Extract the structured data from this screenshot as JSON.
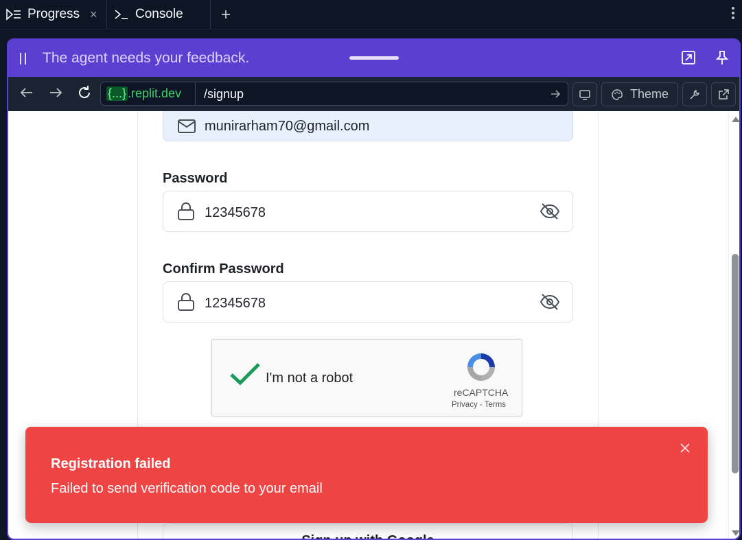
{
  "tabs": [
    {
      "label": "Progress",
      "close": "×"
    },
    {
      "label": "Console"
    }
  ],
  "tab_add": "+",
  "feedback": {
    "text": "The agent needs your feedback."
  },
  "urlbar": {
    "host_braces": "{...}",
    "host_domain": ".replit.dev",
    "path": "/signup",
    "theme_label": "Theme"
  },
  "form": {
    "email_value": "munirarham70@gmail.com",
    "password_label": "Password",
    "password_value": "12345678",
    "confirm_label": "Confirm Password",
    "confirm_value": "12345678",
    "google_button": "Sign up with Google"
  },
  "captcha": {
    "text": "I'm not a robot",
    "brand": "reCAPTCHA",
    "links": "Privacy - Terms"
  },
  "toast": {
    "title": "Registration failed",
    "message": "Failed to send verification code to your email"
  },
  "colors": {
    "accent": "#5b3fd1",
    "toast": "#ef4444",
    "domain": "#3fcf6a"
  }
}
